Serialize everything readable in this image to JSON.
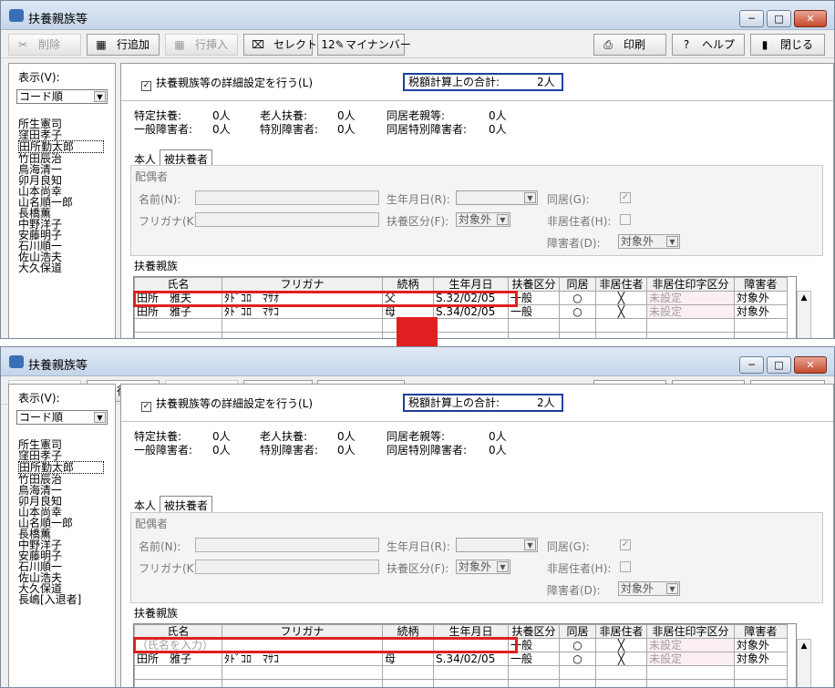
{
  "window": {
    "title": "扶養親族等"
  },
  "toolbar": {
    "delete": "削除",
    "add_row": "行追加",
    "insert_row": "行挿入",
    "select": "セレクト",
    "mynumber": "マイナンバー",
    "print": "印刷",
    "help": "ヘルプ",
    "close": "閉じる"
  },
  "left": {
    "display_label": "表示(V):",
    "sort": "コード順"
  },
  "names_before": [
    "所生憲司",
    "窪田孝子",
    "田所勤太郎",
    "竹田辰治",
    "鳥海清一",
    "卯月良知",
    "山本尚幸",
    "山名順一郎",
    "長橋薫",
    "中野洋子",
    "安藤明子",
    "石川順一",
    "佐山浩夫",
    "大久保道"
  ],
  "names_after": [
    "所生憲司",
    "窪田孝子",
    "田所勤太郎",
    "竹田辰治",
    "鳥海清一",
    "卯月良知",
    "山本尚幸",
    "山名順一郎",
    "長橋薫",
    "中野洋子",
    "安藤明子",
    "石川順一",
    "佐山浩夫",
    "大久保道",
    "長嶋[入退者]"
  ],
  "detail_check": "扶養親族等の詳細設定を行う(L)",
  "total_label": "税額計算上の合計:",
  "total_value": "2人",
  "summary": {
    "tokutei": "特定扶養:",
    "tokutei_v": "0人",
    "rojin": "老人扶養:",
    "rojin_v": "0人",
    "dokyo": "同居老親等:",
    "dokyo_v": "0人",
    "ippan": "一般障害者:",
    "ippan_v": "0人",
    "tokubetsu": "特別障害者:",
    "tokubetsu_v": "0人",
    "dokyo_tokubetsu": "同居特別障害者:",
    "dokyo_tokubetsu_v": "0人"
  },
  "tabs": [
    "本人",
    "被扶養者"
  ],
  "spouse": {
    "group": "配偶者",
    "name": "名前(N):",
    "kana": "フリガナ(K):",
    "birth": "生年月日(R):",
    "class": "扶養区分(F):",
    "class_value": "対象外",
    "dokyo": "同居(G):",
    "hikyoju": "非居住者(H):",
    "disabled": "障害者(D):",
    "disabled_value": "対象外",
    "check": "✓"
  },
  "family_label": "扶養親族",
  "table": {
    "headers": [
      "氏名",
      "フリガナ",
      "続柄",
      "生年月日",
      "扶養区分",
      "同居",
      "非居住者",
      "非居住印字区分",
      "障害者"
    ],
    "rows_before": [
      [
        "田所　雅夫",
        "ﾀﾄﾞｺﾛ　ﾏｻｵ",
        "父",
        "S.32/02/05",
        "一般",
        "○",
        "╳",
        "未設定",
        "対象外"
      ],
      [
        "田所　雅子",
        "ﾀﾄﾞｺﾛ　ﾏｻｺ",
        "母",
        "S.34/02/05",
        "一般",
        "○",
        "╳",
        "未設定",
        "対象外"
      ]
    ],
    "rows_after": [
      [
        "（氏名を入力）",
        "",
        "",
        "",
        "一般",
        "○",
        "╳",
        "未設定",
        "対象外"
      ],
      [
        "田所　雅子",
        "ﾀﾄﾞｺﾛ　ﾏｻｺ",
        "母",
        "S.34/02/05",
        "一般",
        "○",
        "╳",
        "未設定",
        "対象外"
      ]
    ]
  },
  "icons": {
    "minimize": "─",
    "maximize": "□",
    "close": "✕",
    "scroll_up": "▲",
    "dropdown": "▼",
    "checked": "✓",
    "delete": "✂",
    "add": "▦",
    "insert": "▦",
    "select": "⌧",
    "mynumber": "12✎",
    "print": "⎙",
    "help": "?",
    "close_door": "▮"
  },
  "colors": {
    "accent_red": "#e02020",
    "total_border": "#1f3fa0"
  }
}
